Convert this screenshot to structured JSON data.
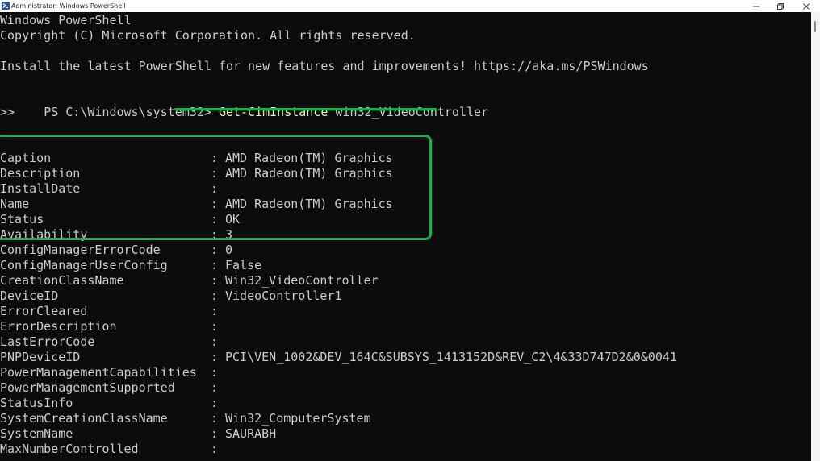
{
  "window": {
    "title": "Administrator: Windows PowerShell",
    "controls": [
      "minimize",
      "restore",
      "close"
    ]
  },
  "console": {
    "header": [
      "Windows PowerShell",
      "Copyright (C) Microsoft Corporation. All rights reserved.",
      "",
      "Install the latest PowerShell for new features and improvements! https://aka.ms/PSWindows",
      ""
    ],
    "prompt": "PS C:\\Windows\\system32> ",
    "command": "Get-CimInstance",
    "argument": " win32_VideoController",
    "continuation": ">>",
    "separator": ":",
    "properties": [
      {
        "name": "Caption",
        "value": "AMD Radeon(TM) Graphics"
      },
      {
        "name": "Description",
        "value": "AMD Radeon(TM) Graphics"
      },
      {
        "name": "InstallDate",
        "value": ""
      },
      {
        "name": "Name",
        "value": "AMD Radeon(TM) Graphics"
      },
      {
        "name": "Status",
        "value": "OK"
      },
      {
        "name": "Availability",
        "value": "3"
      },
      {
        "name": "ConfigManagerErrorCode",
        "value": "0"
      },
      {
        "name": "ConfigManagerUserConfig",
        "value": "False"
      },
      {
        "name": "CreationClassName",
        "value": "Win32_VideoController"
      },
      {
        "name": "DeviceID",
        "value": "VideoController1"
      },
      {
        "name": "ErrorCleared",
        "value": ""
      },
      {
        "name": "ErrorDescription",
        "value": ""
      },
      {
        "name": "LastErrorCode",
        "value": ""
      },
      {
        "name": "PNPDeviceID",
        "value": "PCI\\VEN_1002&DEV_164C&SUBSYS_1413152D&REV_C2\\4&33D747D2&0&0041"
      },
      {
        "name": "PowerManagementCapabilities",
        "value": ""
      },
      {
        "name": "PowerManagementSupported",
        "value": ""
      },
      {
        "name": "StatusInfo",
        "value": ""
      },
      {
        "name": "SystemCreationClassName",
        "value": "Win32_ComputerSystem"
      },
      {
        "name": "SystemName",
        "value": "SAURABH"
      },
      {
        "name": "MaxNumberControlled",
        "value": ""
      }
    ]
  },
  "colors": {
    "console_background": "#0c0c0c",
    "console_text": "#cccccc",
    "command_text": "#f9f1a5",
    "annotation_green": "#12b24c"
  },
  "icons": {
    "app": "powershell-icon",
    "minimize": "minimize-icon",
    "restore": "restore-icon",
    "close": "close-icon"
  }
}
